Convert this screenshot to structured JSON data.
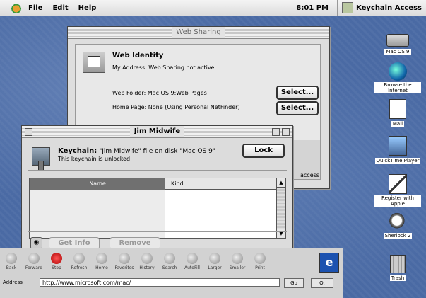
{
  "menubar": {
    "items": [
      "File",
      "Edit",
      "Help"
    ],
    "clock": "8:01 PM",
    "app_name": "Keychain Access"
  },
  "web_sharing": {
    "title": "Web Sharing",
    "heading": "Web Identity",
    "my_address_label": "My Address:",
    "my_address_value": "Web Sharing not active",
    "web_folder_label": "Web Folder:",
    "web_folder_value": "Mac OS 9:Web Pages",
    "home_page_label": "Home Page:",
    "home_page_value": "None (Using Personal NetFinder)",
    "select_label": "Select...",
    "access_text": "access"
  },
  "keychain": {
    "title": "Jim Midwife",
    "label": "Keychain:",
    "description": "\"Jim Midwife\" file on disk \"Mac OS 9\"",
    "status": "This keychain is unlocked",
    "lock_button": "Lock",
    "columns": [
      "Name",
      "Kind"
    ],
    "get_info_button": "Get Info",
    "remove_button": "Remove"
  },
  "browser": {
    "tools": [
      "Back",
      "Forward",
      "Stop",
      "Refresh",
      "Home",
      "Favorites",
      "History",
      "Search",
      "AutoFill",
      "Larger",
      "Smaller",
      "Print"
    ],
    "address_label": "Address",
    "url": "http://www.microsoft.com/mac/",
    "go_label": "Go",
    "search_label": "Q."
  },
  "desktop_icons": [
    "Mac OS 9",
    "Browse the Internet",
    "Mail",
    "QuickTime Player",
    "Register with Apple",
    "Sherlock 2",
    "Trash"
  ]
}
